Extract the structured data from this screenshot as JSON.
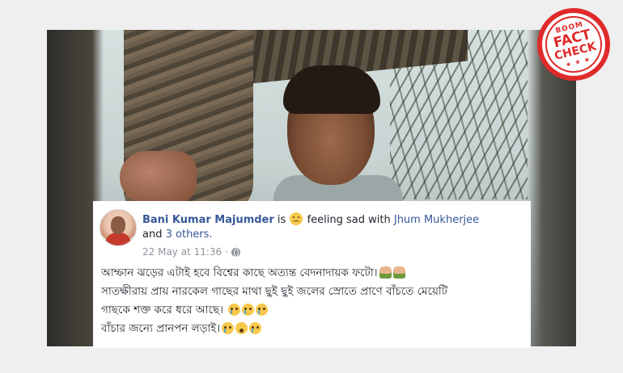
{
  "stamp": {
    "brand": "BOOM",
    "line1": "FACT",
    "line2": "CHECK",
    "stars": "★ ★ ★",
    "color": "#e02a2a"
  },
  "post": {
    "author": "Bani Kumar Majumder",
    "is_text": "is",
    "feeling": "feeling sad with",
    "tagged": "Jhum Mukherjee",
    "and_text": "and",
    "others": "3 others.",
    "timestamp": "22 May at 11:36",
    "separator": "·",
    "privacy_icon": "globe-icon",
    "lines": [
      "আম্ফান ঝড়ের এটাই হবে বিশ্বের কাছে অত্যন্ত বেদনাদায়ক ফটো।",
      "সাতক্ষীরায় প্রায় নারকেল গাছের মাথা ছুই ছুই জলের স্রোতে প্রাণে বাঁচতে মেয়েটি",
      "গাছকে শক্ত করে ধরে আছে।",
      "বাঁচার জন্যে প্রানপন লড়াই।"
    ],
    "link_color": "#365899"
  }
}
